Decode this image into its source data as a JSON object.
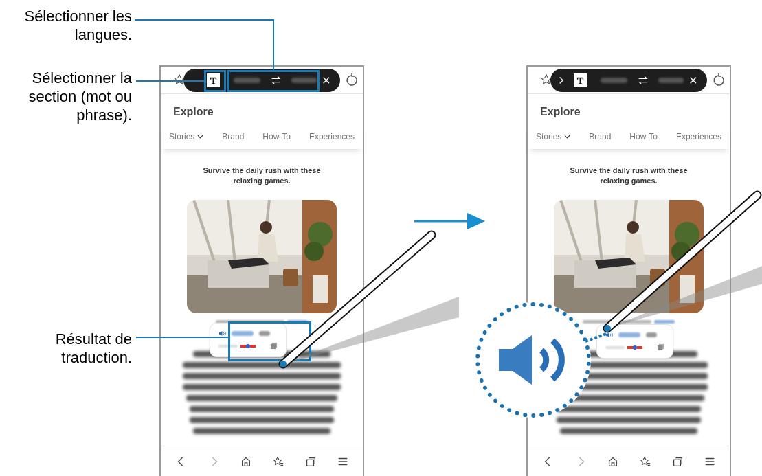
{
  "callouts": [
    {
      "text": "Sélectionner les langues."
    },
    {
      "text": "Sélectionner la section (mot ou phrase)."
    },
    {
      "text": "Résultat de traduction."
    }
  ],
  "screens": [
    {
      "highlighted": true,
      "magnified": false,
      "toolbar": {
        "chevron": false
      },
      "page_title": "Explore",
      "tabs": [
        {
          "label": "Stories",
          "dropdown": true
        },
        {
          "label": "Brand",
          "dropdown": false
        },
        {
          "label": "How-To",
          "dropdown": false
        },
        {
          "label": "Experiences",
          "dropdown": false
        }
      ],
      "headline": "Survive the daily rush with these relaxing games."
    },
    {
      "highlighted": false,
      "magnified": true,
      "toolbar": {
        "chevron": true
      },
      "page_title": "Explore",
      "tabs": [
        {
          "label": "Stories",
          "dropdown": true
        },
        {
          "label": "Brand",
          "dropdown": false
        },
        {
          "label": "How-To",
          "dropdown": false
        },
        {
          "label": "Experiences",
          "dropdown": false
        }
      ],
      "headline": "Survive the daily rush with these relaxing games."
    }
  ]
}
